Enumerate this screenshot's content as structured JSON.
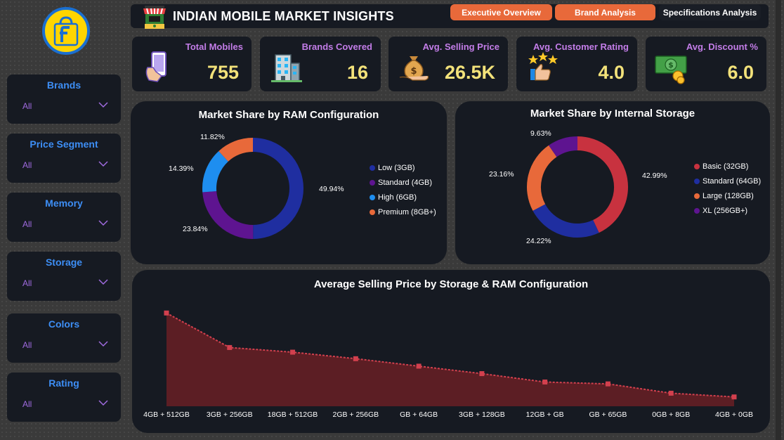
{
  "header": {
    "title": "INDIAN MOBILE MARKET INSIGHTS",
    "tabs": [
      {
        "label": "Executive Overview",
        "active": false
      },
      {
        "label": "Brand Analysis",
        "active": false
      },
      {
        "label": "Specifications Analysis",
        "active": true
      }
    ]
  },
  "filters": [
    {
      "title": "Brands",
      "value": "All"
    },
    {
      "title": "Price Segment",
      "value": "All"
    },
    {
      "title": "Memory",
      "value": "All"
    },
    {
      "title": "Storage",
      "value": "All"
    },
    {
      "title": "Colors",
      "value": "All"
    },
    {
      "title": "Rating",
      "value": "All"
    }
  ],
  "kpis": [
    {
      "label": "Total Mobiles",
      "value": "755",
      "icon": "phone-in-hand-icon"
    },
    {
      "label": "Brands Covered",
      "value": "16",
      "icon": "building-icon"
    },
    {
      "label": "Avg. Selling Price",
      "value": "26.5K",
      "icon": "money-bag-icon"
    },
    {
      "label": "Avg. Customer Rating",
      "value": "4.0",
      "icon": "thumbs-up-stars-icon"
    },
    {
      "label": "Avg. Discount %",
      "value": "6.0",
      "icon": "cash-coins-icon"
    }
  ],
  "colors": {
    "accent_orange": "#e8693a",
    "kpi_value": "#f3e27a",
    "kpi_label": "#c37de8",
    "filter_title": "#3d8ef5",
    "area_fill": "#5c1e24",
    "area_line": "#d2404e"
  },
  "chart_data": [
    {
      "type": "pie",
      "title": "Market Share by RAM Configuration",
      "series": [
        {
          "name": "Low (3GB)",
          "value": 49.94,
          "label": "49.94%",
          "color": "#1f2ea0"
        },
        {
          "name": "Standard (4GB)",
          "value": 23.84,
          "label": "23.84%",
          "color": "#5e1490"
        },
        {
          "name": "High (6GB)",
          "value": 14.39,
          "label": "14.39%",
          "color": "#1e8ef0"
        },
        {
          "name": "Premium (8GB+)",
          "value": 11.82,
          "label": "11.82%",
          "color": "#e8693a"
        }
      ],
      "legend": "right"
    },
    {
      "type": "pie",
      "title": "Market Share by Internal Storage",
      "series": [
        {
          "name": "Basic (32GB)",
          "value": 42.99,
          "label": "42.99%",
          "color": "#c8323f"
        },
        {
          "name": "Standard (64GB)",
          "value": 24.22,
          "label": "24.22%",
          "color": "#1f2ea0"
        },
        {
          "name": "Large (128GB)",
          "value": 23.16,
          "label": "23.16%",
          "color": "#e8693a"
        },
        {
          "name": "XL (256GB+)",
          "value": 9.63,
          "label": "9.63%",
          "color": "#5e1490"
        }
      ],
      "legend": "right"
    },
    {
      "type": "area",
      "title": "Average Selling Price by Storage & RAM Configuration",
      "categories": [
        "4GB + 512GB",
        "3GB + 256GB",
        "18GB + 512GB",
        "2GB + 256GB",
        "GB + 64GB",
        "3GB + 128GB",
        "12GB + GB",
        "GB + 65GB",
        "0GB + 8GB",
        "4GB + 0GB"
      ],
      "values": [
        100,
        63,
        58,
        51,
        43,
        35,
        26,
        24,
        14,
        10
      ],
      "ylim": [
        0,
        110
      ],
      "grid": false
    }
  ]
}
